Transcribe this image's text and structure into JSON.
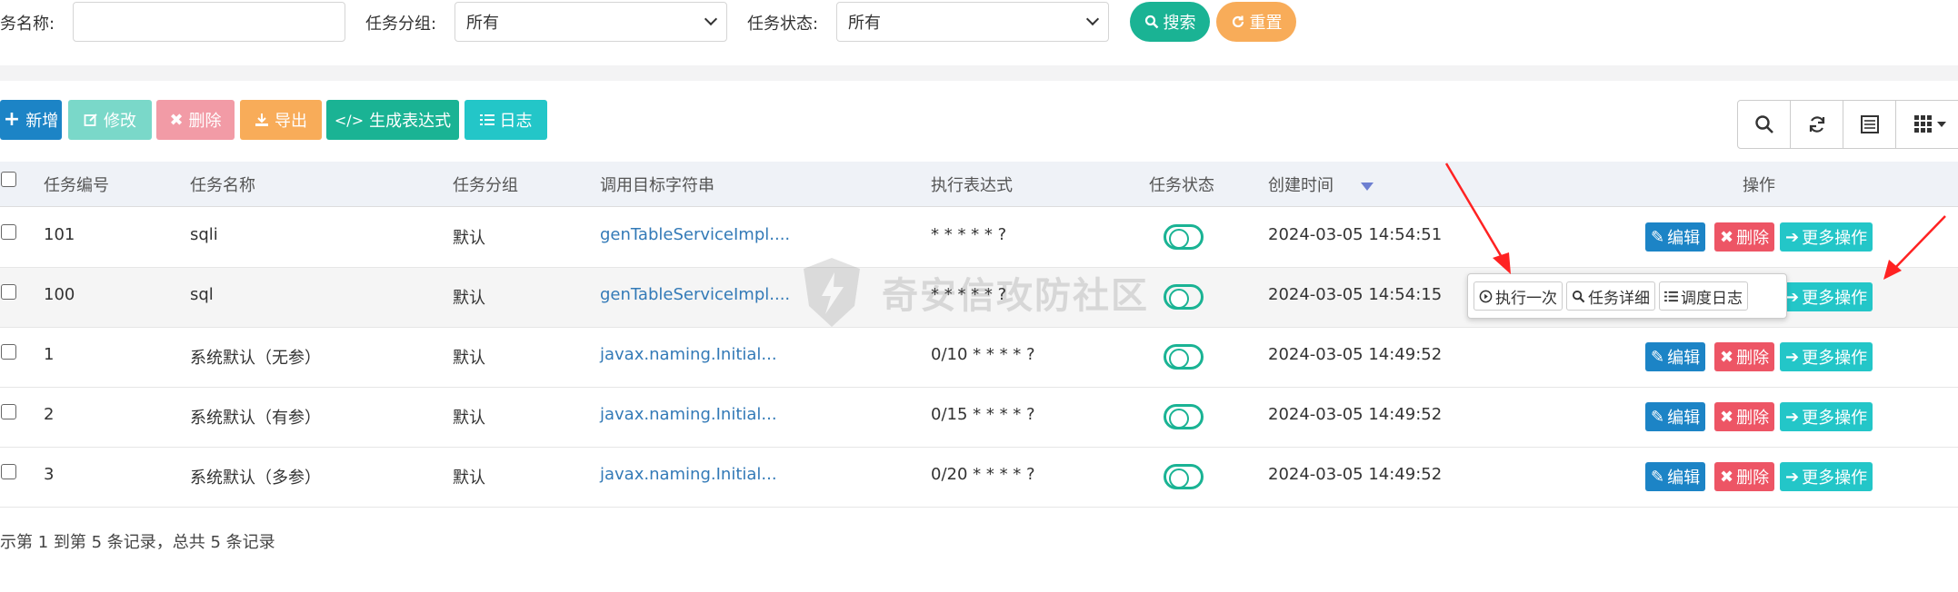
{
  "search": {
    "task_name_label": "务名称:",
    "task_name_value": "",
    "task_group_label": "任务分组:",
    "task_group_value": "所有",
    "task_status_label": "任务状态:",
    "task_status_value": "所有",
    "search_button": "搜索",
    "reset_button": "重置"
  },
  "toolbar": {
    "add": "新增",
    "edit": "修改",
    "delete": "删除",
    "export": "导出",
    "cron": "生成表达式",
    "log": "日志"
  },
  "columns": [
    "任务编号",
    "任务名称",
    "任务分组",
    "调用目标字符串",
    "执行表达式",
    "任务状态",
    "创建时间",
    "操作"
  ],
  "rows": [
    {
      "id": "101",
      "name": "sqli",
      "group": "默认",
      "target": "genTableServiceImpl....",
      "cron": "* * * * * ?",
      "created": "2024-03-05 14:54:51",
      "status_on": true
    },
    {
      "id": "100",
      "name": "sql",
      "group": "默认",
      "target": "genTableServiceImpl....",
      "cron": "* * * * * ?",
      "created": "2024-03-05 14:54:15",
      "status_on": true
    },
    {
      "id": "1",
      "name": "系统默认（无参）",
      "group": "默认",
      "target": "javax.naming.Initial...",
      "cron": "0/10 * * * * ?",
      "created": "2024-03-05 14:49:52",
      "status_on": true
    },
    {
      "id": "2",
      "name": "系统默认（有参）",
      "group": "默认",
      "target": "javax.naming.Initial...",
      "cron": "0/15 * * * * ?",
      "created": "2024-03-05 14:49:52",
      "status_on": true
    },
    {
      "id": "3",
      "name": "系统默认（多参）",
      "group": "默认",
      "target": "javax.naming.Initial...",
      "cron": "0/20 * * * * ?",
      "created": "2024-03-05 14:49:52",
      "status_on": true
    }
  ],
  "actions": {
    "edit": "编辑",
    "delete": "删除",
    "more": "更多操作"
  },
  "popup": {
    "run_once": "执行一次",
    "detail": "任务详细",
    "schedule_log": "调度日志"
  },
  "footer": {
    "summary": "示第 1 到第 5 条记录，总共 5 条记录"
  },
  "watermark": {
    "text": "奇安信攻防社区"
  },
  "colors": {
    "primary_green": "#1ab394",
    "warning_orange": "#f8ac59",
    "blue": "#1c84c6",
    "red": "#ed5565",
    "cyan": "#23c6c8",
    "light_teal": "#7ad8c9",
    "pink": "#f29ba6",
    "annotation_red": "#ff2222"
  }
}
